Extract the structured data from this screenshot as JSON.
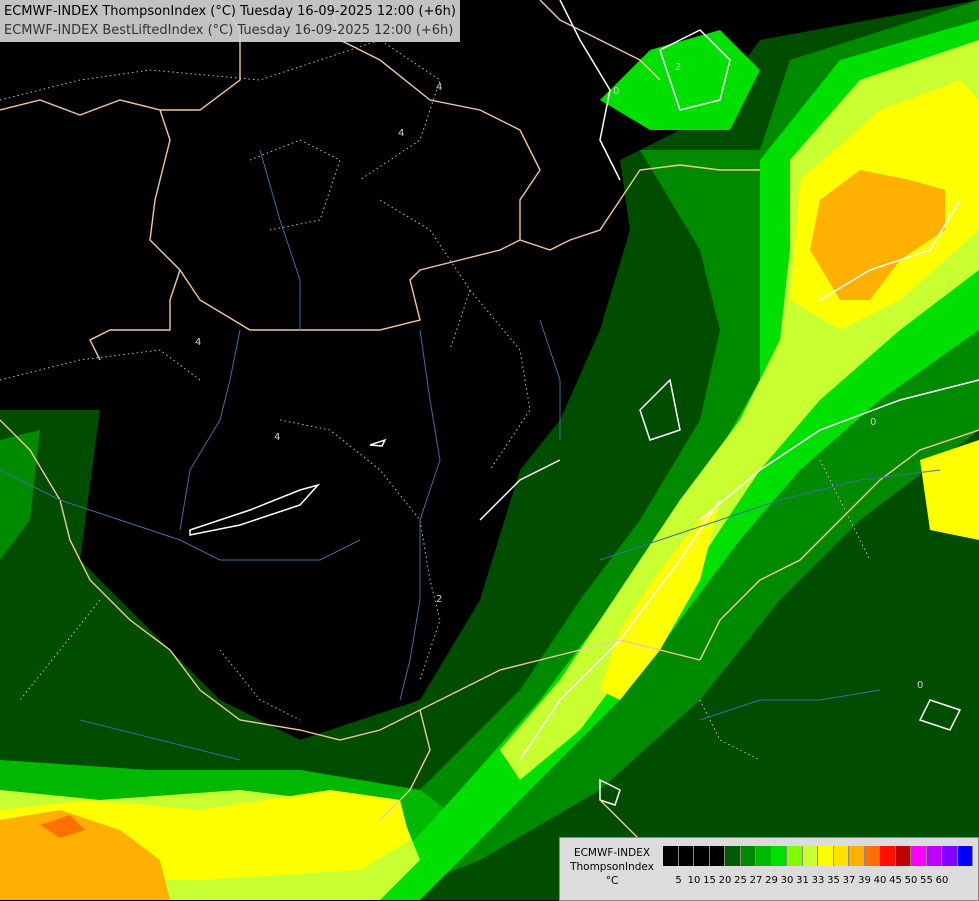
{
  "titles": {
    "line1": "ECMWF-INDEX ThompsonIndex (°C) Tuesday 16-09-2025 12:00 (+6h)",
    "line2": "ECMWF-INDEX BestLiftedIndex (°C) Tuesday 16-09-2025 12:00 (+6h)"
  },
  "legend": {
    "model": "ECMWF-INDEX",
    "parameter": "ThompsonIndex",
    "unit": "°C",
    "ticks": [
      "5",
      "10",
      "15",
      "20",
      "25",
      "27",
      "29",
      "30",
      "31",
      "33",
      "35",
      "37",
      "39",
      "40",
      "45",
      "50",
      "55",
      "60"
    ],
    "colors": [
      "#000000",
      "#000000",
      "#000000",
      "#000000",
      "#005a00",
      "#008a00",
      "#00b800",
      "#00e000",
      "#7fff00",
      "#c8ff30",
      "#ffff00",
      "#ffe000",
      "#ffb000",
      "#ff7000",
      "#ff1000",
      "#c00000",
      "#ff00ff",
      "#c000ff",
      "#8000ff",
      "#0000ff"
    ]
  },
  "contour_labels": [
    "4",
    "4",
    "4",
    "4",
    "2",
    "0",
    "0",
    "2",
    "0"
  ]
}
